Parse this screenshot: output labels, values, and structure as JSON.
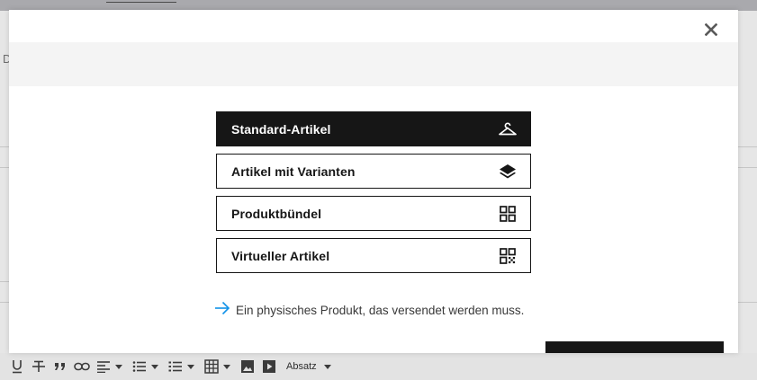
{
  "background": {
    "left_letter": "D",
    "toolbar": {
      "paragraph_format_label": "Absatz"
    }
  },
  "modal": {
    "close_icon": "close-icon",
    "options": [
      {
        "label": "Standard-Artikel",
        "icon": "hanger-icon",
        "selected": true
      },
      {
        "label": "Artikel mit Varianten",
        "icon": "layers-icon",
        "selected": false
      },
      {
        "label": "Produktbündel",
        "icon": "grid-icon",
        "selected": false
      },
      {
        "label": "Virtueller Artikel",
        "icon": "qr-code-icon",
        "selected": false
      }
    ],
    "description": "Ein physisches Produkt, das versendet werden muss.",
    "description_icon": "arrow-right-icon"
  },
  "colors": {
    "selected_background": "#161616",
    "accent_arrow": "#1192e8",
    "band": "#f4f4f4"
  }
}
